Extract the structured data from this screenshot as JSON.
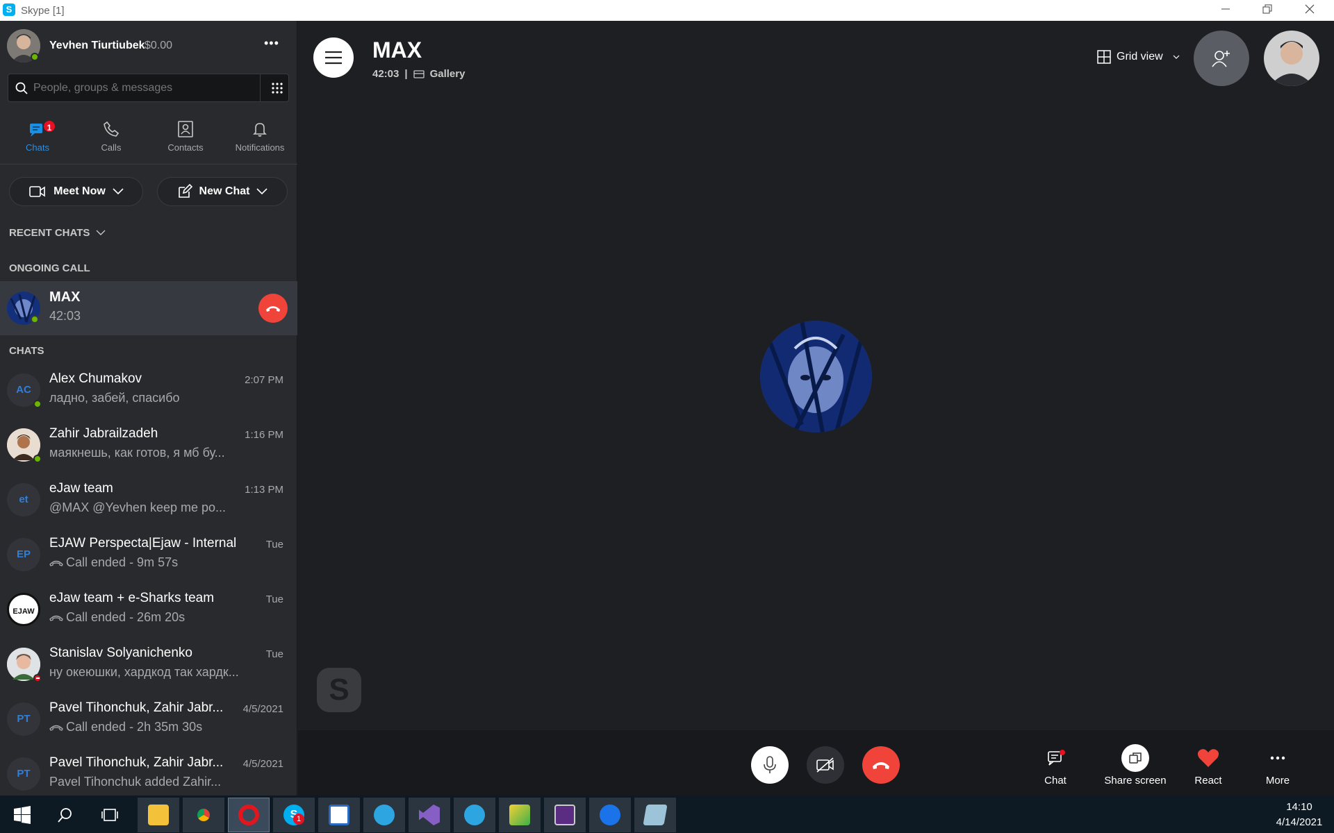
{
  "window": {
    "title": "Skype [1]",
    "logo": "S"
  },
  "user": {
    "name": "Yevhen Tiurtiubek",
    "balance": "$0.00",
    "more": "•••"
  },
  "search": {
    "placeholder": "People, groups & messages"
  },
  "nav": {
    "chats": {
      "label": "Chats",
      "badge": "1"
    },
    "calls": {
      "label": "Calls"
    },
    "contacts": {
      "label": "Contacts"
    },
    "notifications": {
      "label": "Notifications"
    }
  },
  "actions": {
    "meet_now": "Meet Now",
    "new_chat": "New Chat"
  },
  "sections": {
    "recent": "RECENT CHATS",
    "ongoing": "ONGOING CALL",
    "chats": "CHATS"
  },
  "ongoing_call": {
    "name": "MAX",
    "duration": "42:03"
  },
  "chats": [
    {
      "name": "Alex Chumakov",
      "msg": "ладно, забей, спасибо",
      "time": "2:07 PM",
      "initials": "AC"
    },
    {
      "name": "Zahir Jabrailzadeh",
      "msg": "маякнешь, как готов, я мб бу...",
      "time": "1:16 PM",
      "initials": ""
    },
    {
      "name": "eJaw team",
      "msg": "@MAX @Yevhen keep me po...",
      "time": "1:13 PM",
      "initials": "et"
    },
    {
      "name": "EJAW Perspecta|Ejaw - Internal",
      "msg": "Call ended - 9m 57s",
      "time": "Tue",
      "initials": "EP"
    },
    {
      "name": "eJaw team + e-Sharks team",
      "msg": "Call ended - 26m 20s",
      "time": "Tue",
      "initials": "EJAW"
    },
    {
      "name": "Stanislav Solyanichenko",
      "msg": "ну океюшки, хардкод так хардк...",
      "time": "Tue",
      "initials": ""
    },
    {
      "name": "Pavel Tihonchuk, Zahir Jabr...",
      "msg": "Call ended - 2h 35m 30s",
      "time": "4/5/2021",
      "initials": "PT"
    },
    {
      "name": "Pavel Tihonchuk, Zahir Jabr...",
      "msg": "Pavel Tihonchuk added Zahir...",
      "time": "4/5/2021",
      "initials": "PT"
    }
  ],
  "call": {
    "name": "MAX",
    "duration": "42:03",
    "separator": "|",
    "view_mode": "Gallery",
    "grid_view": "Grid view",
    "watermark": "S"
  },
  "controls": {
    "chat": "Chat",
    "share": "Share screen",
    "react": "React",
    "more": "More"
  },
  "taskbar": {
    "time": "14:10",
    "date": "4/14/2021",
    "skype_badge": "1"
  },
  "colors": {
    "accent": "#00aff0",
    "end_call": "#f0433a",
    "online": "#6bb700",
    "busy": "#e81123",
    "react": "#f0433a"
  }
}
